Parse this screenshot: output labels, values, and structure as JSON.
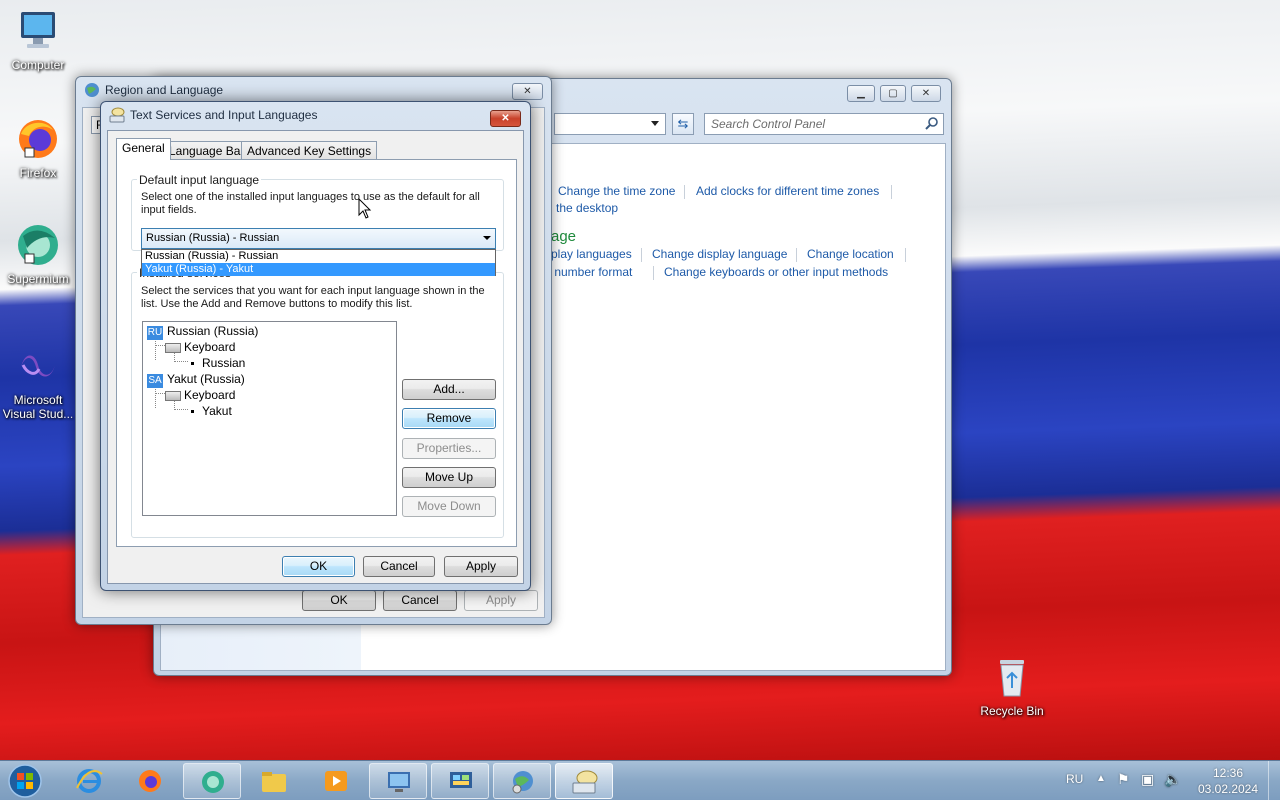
{
  "desktop": {
    "icons": [
      {
        "label": "Computer",
        "icon": "computer-icon"
      },
      {
        "label": "Firefox",
        "icon": "firefox-icon"
      },
      {
        "label": "Supermium",
        "icon": "supermium-icon"
      },
      {
        "label": "Microsoft Visual Stud...",
        "icon": "visual-studio-icon"
      },
      {
        "label": "Recycle Bin",
        "icon": "recycle-bin-icon"
      }
    ]
  },
  "control_panel": {
    "search_placeholder": "Search Control Panel",
    "links": {
      "time_zone": "Change the time zone",
      "clocks": "Add clocks for different time zones",
      "desktop": "the desktop",
      "heading": "age",
      "languages": "play languages",
      "display_language": "Change display language",
      "location": "Change location",
      "number_format": "r number format",
      "keyboards": "Change keyboards or other input methods"
    }
  },
  "region_language": {
    "title": "Region and Language",
    "tab_fragment": "F",
    "buttons": {
      "ok": "OK",
      "cancel": "Cancel",
      "apply": "Apply"
    }
  },
  "text_services": {
    "title": "Text Services and Input Languages",
    "tabs": [
      "General",
      "Language Bar",
      "Advanced Key Settings"
    ],
    "default_input_group": "Default input language",
    "default_input_desc": "Select one of the installed input languages to use as the default for all input fields.",
    "combo_value": "Russian (Russia) - Russian",
    "dropdown_options": [
      "Russian (Russia) - Russian",
      "Yakut (Russia) - Yakut"
    ],
    "dropdown_selected_index": 1,
    "installed_group": "Installed services",
    "installed_desc": "Select the services that you want for each input language shown in the list. Use the Add and Remove buttons to modify this list.",
    "tree": [
      {
        "badge": "RU",
        "language": "Russian (Russia)",
        "category": "Keyboard",
        "layout": "Russian"
      },
      {
        "badge": "SA",
        "language": "Yakut (Russia)",
        "category": "Keyboard",
        "layout": "Yakut"
      }
    ],
    "side_buttons": {
      "add": "Add...",
      "remove": "Remove",
      "properties": "Properties...",
      "move_up": "Move Up",
      "move_down": "Move Down"
    },
    "buttons": {
      "ok": "OK",
      "cancel": "Cancel",
      "apply": "Apply"
    }
  },
  "taskbar": {
    "language": "RU",
    "time": "12:36",
    "date": "03.02.2024",
    "items": [
      "start-orb",
      "internet-explorer-icon",
      "firefox-icon",
      "supermium-icon",
      "file-explorer-icon",
      "media-player-icon",
      "remote-desktop-icon",
      "control-panel-icon",
      "region-globe-icon",
      "keyboard-icon"
    ]
  }
}
